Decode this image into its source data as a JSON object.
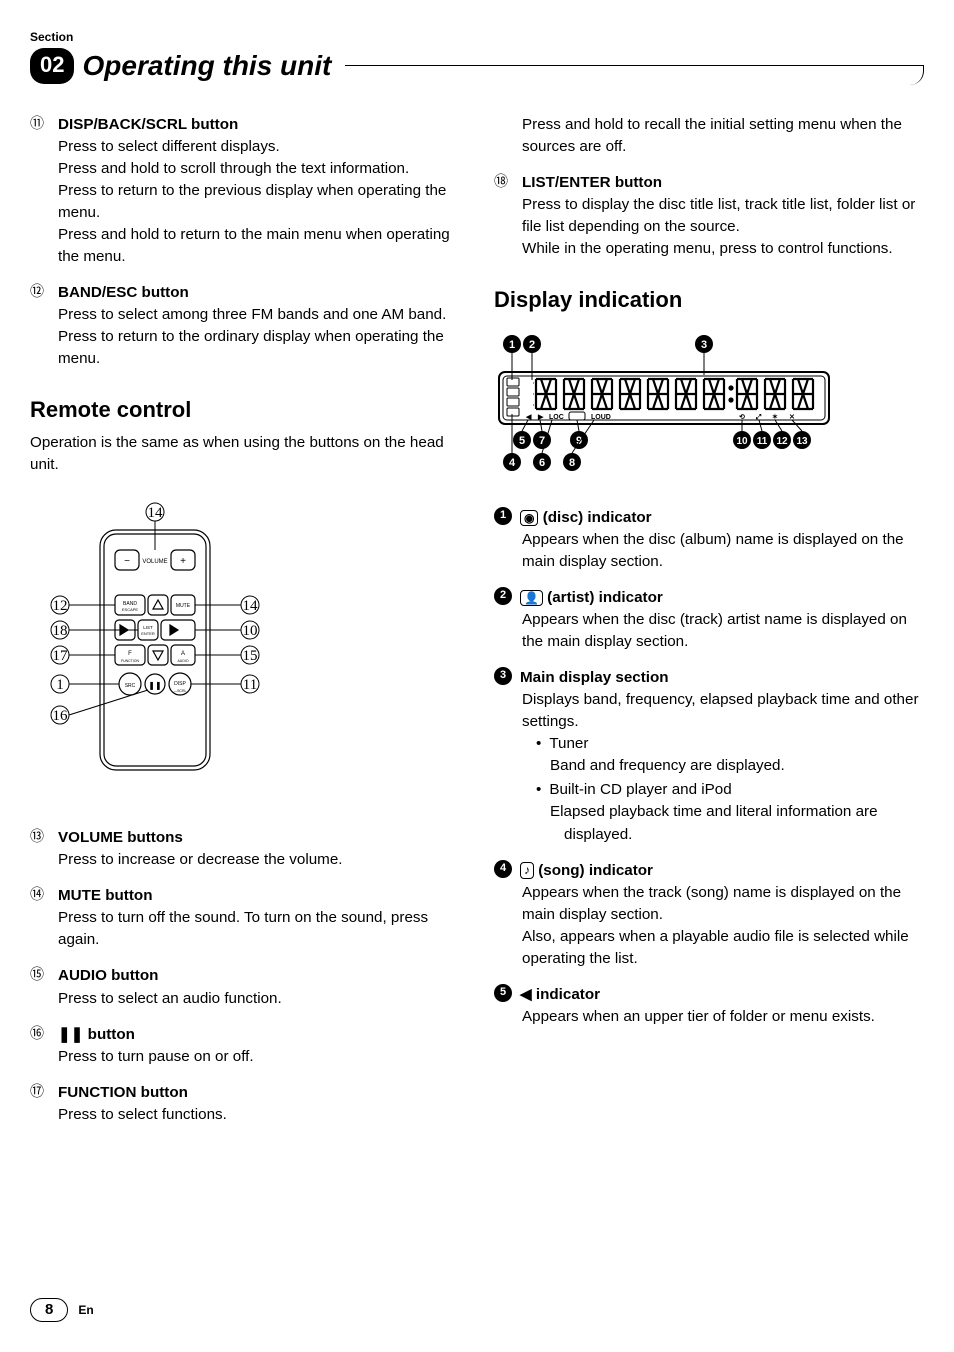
{
  "header": {
    "section_label": "Section",
    "section_number": "02",
    "chapter_title": "Operating this unit"
  },
  "left_column": {
    "items": [
      {
        "marker": "⑪",
        "title": "DISP/BACK/SCRL button",
        "body": "Press to select different displays.\nPress and hold to scroll through the text information.\nPress to return to the previous display when operating the menu.\nPress and hold to return to the main menu when operating the menu."
      },
      {
        "marker": "⑫",
        "title": "BAND/ESC button",
        "body": "Press to select among three FM bands and one AM band.\nPress to return to the ordinary display when operating the menu."
      }
    ],
    "remote_heading": "Remote control",
    "remote_intro": "Operation is the same as when using the buttons on the head unit.",
    "remote_callouts": {
      "top": "⑭",
      "left": [
        "⑫",
        "⑱",
        "⑰",
        "①",
        "⑯"
      ],
      "right": [
        "⑭",
        "⑩",
        "⑮",
        "⑪"
      ],
      "buttons": {
        "volume": "VOLUME",
        "band": "BAND",
        "band_sub": "ESCAPE",
        "mute": "MUTE",
        "list": "LIST",
        "list_sub": "ENTER",
        "f": "F",
        "f_sub": "FUNCTION",
        "a": "A",
        "a_sub": "AUDIO",
        "src": "SRC",
        "disp": "DISP",
        "disp_sub": "—SCRL"
      }
    },
    "items2": [
      {
        "marker": "⑬",
        "title": "VOLUME buttons",
        "body": "Press to increase or decrease the volume."
      },
      {
        "marker": "⑭",
        "title": "MUTE button",
        "body": "Press to turn off the sound. To turn on the sound, press again."
      },
      {
        "marker": "⑮",
        "title": "AUDIO button",
        "body": "Press to select an audio function."
      },
      {
        "marker": "⑯",
        "title": "❚❚ button",
        "body": "Press to turn pause on or off."
      },
      {
        "marker": "⑰",
        "title": "FUNCTION button",
        "body": "Press to select functions."
      }
    ]
  },
  "right_column": {
    "cont_item17_body": "Press and hold to recall the initial setting menu when the sources are off.",
    "item18": {
      "marker": "⑱",
      "title": "LIST/ENTER button",
      "body": "Press to display the disc title list, track title list, folder list or file list depending on the source.\nWhile in the operating menu, press to control functions."
    },
    "display_heading": "Display indication",
    "display_callouts": {
      "top": [
        "1",
        "2",
        "3"
      ],
      "bottom_row1": [
        "5",
        "7",
        "9",
        "10",
        "11",
        "12",
        "13"
      ],
      "bottom_row2": [
        "4",
        "6",
        "8"
      ],
      "lcd_text": {
        "loc": "LOC",
        "loud": "LOUD"
      }
    },
    "display_items": [
      {
        "marker": "1",
        "icon": "◉",
        "title": " (disc) indicator",
        "body": "Appears when the disc (album) name is displayed on the main display section."
      },
      {
        "marker": "2",
        "icon": "👤",
        "title": " (artist) indicator",
        "body": "Appears when the disc (track) artist name is displayed on the main display section."
      },
      {
        "marker": "3",
        "icon": "",
        "title": "Main display section",
        "body_intro": "Displays band, frequency, elapsed playback time and other settings.",
        "bullets": [
          {
            "head": "Tuner",
            "text": "Band and frequency are displayed."
          },
          {
            "head": "Built-in CD player and iPod",
            "text": "Elapsed playback time and literal information are displayed."
          }
        ]
      },
      {
        "marker": "4",
        "icon": "♪",
        "title": " (song) indicator",
        "body": "Appears when the track (song) name is displayed on the main display section.\nAlso, appears when a playable audio file is selected while operating the list."
      },
      {
        "marker": "5",
        "icon": "◀",
        "title": " indicator",
        "body": "Appears when an upper tier of folder or menu exists."
      }
    ]
  },
  "footer": {
    "page": "8",
    "lang": "En"
  }
}
